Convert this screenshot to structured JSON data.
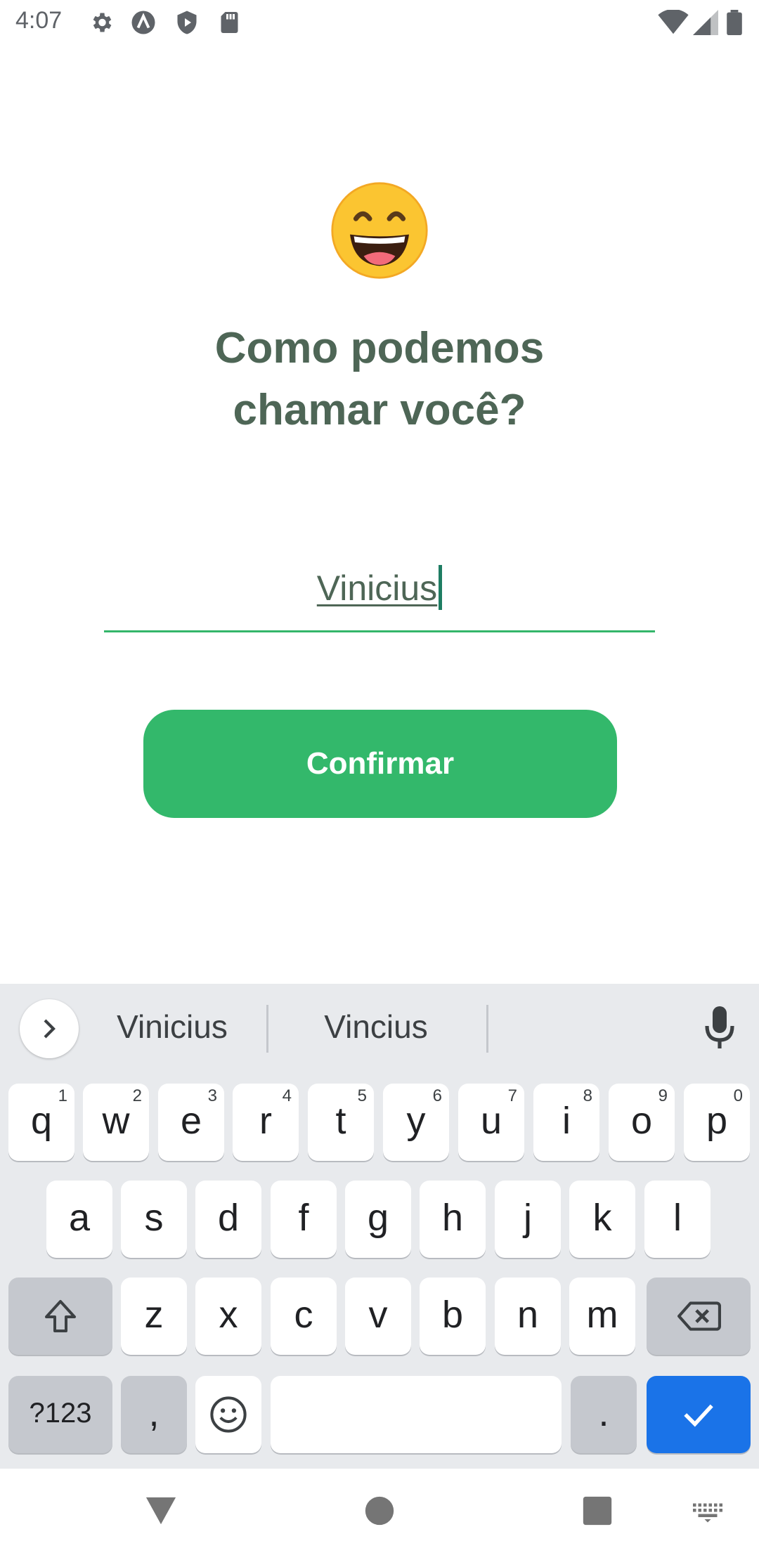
{
  "status_bar": {
    "time": "4:07",
    "left_icons": [
      "settings-icon",
      "accessibility-icon",
      "shield-icon",
      "sd-card-icon"
    ],
    "right_icons": [
      "wifi-icon",
      "signal-icon",
      "battery-icon"
    ]
  },
  "screen": {
    "emoji": "smiling-face-icon",
    "title": "Como podemos\nchamar você?",
    "name_field": {
      "value": "Vinicius"
    },
    "confirm_label": "Confirmar"
  },
  "keyboard": {
    "suggestions": [
      "Vinicius",
      "Vincius"
    ],
    "row1": [
      {
        "label": "q",
        "hint": "1"
      },
      {
        "label": "w",
        "hint": "2"
      },
      {
        "label": "e",
        "hint": "3"
      },
      {
        "label": "r",
        "hint": "4"
      },
      {
        "label": "t",
        "hint": "5"
      },
      {
        "label": "y",
        "hint": "6"
      },
      {
        "label": "u",
        "hint": "7"
      },
      {
        "label": "i",
        "hint": "8"
      },
      {
        "label": "o",
        "hint": "9"
      },
      {
        "label": "p",
        "hint": "0"
      }
    ],
    "row2": [
      "a",
      "s",
      "d",
      "f",
      "g",
      "h",
      "j",
      "k",
      "l"
    ],
    "row3": [
      "z",
      "x",
      "c",
      "v",
      "b",
      "n",
      "m"
    ],
    "symbols_label": "?123",
    "comma_label": ",",
    "period_label": "."
  },
  "colors": {
    "accent_green": "#33b86b",
    "title_color": "#4e6656",
    "keyboard_action_blue": "#1a73e8"
  }
}
